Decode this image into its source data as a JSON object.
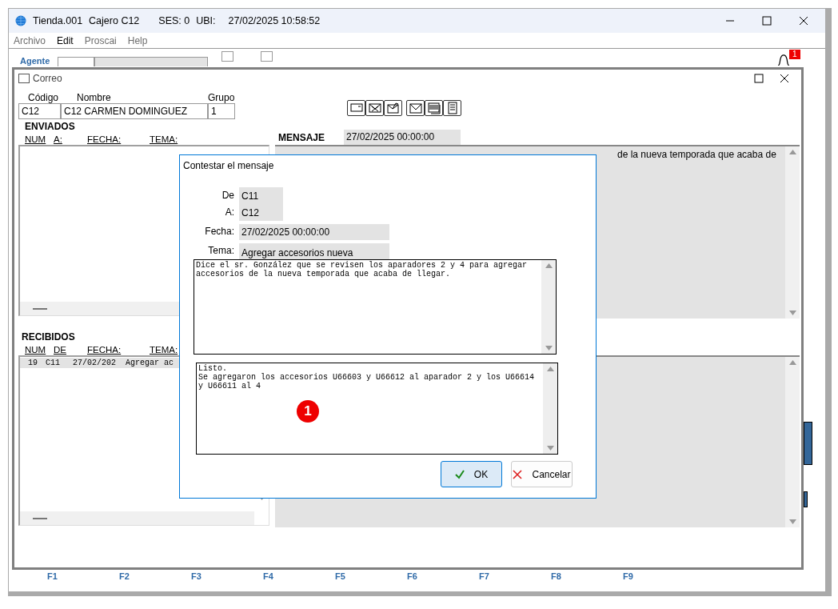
{
  "app_window": {
    "title": "Tienda.001",
    "cashier": "Cajero C12",
    "session": "SES: 0",
    "location_label": "UBI:",
    "datetime": "27/02/2025 10:58:52"
  },
  "menu": [
    {
      "label": "Archivo",
      "disabled": true
    },
    {
      "label": "Edit",
      "disabled": false
    },
    {
      "label": "Proscai",
      "disabled": true
    },
    {
      "label": "Help",
      "disabled": true
    }
  ],
  "agent": {
    "label": "Agente"
  },
  "checkboxes": [
    {
      "checked": false
    },
    {
      "checked": false
    }
  ],
  "notifications": {
    "count": "1"
  },
  "function_keys": [
    "F1",
    "F2",
    "F3",
    "F4",
    "F5",
    "F6",
    "F7",
    "F8",
    "F9"
  ],
  "mail_window": {
    "title": "Correo",
    "fields": [
      {
        "label": "Código",
        "value": "C12"
      },
      {
        "label": "Nombre",
        "value": "C12 CARMEN DOMINGUEZ"
      },
      {
        "label": "Grupo",
        "value": "1"
      }
    ],
    "sent": {
      "title": "ENVIADOS",
      "columns": [
        "NUM",
        "A:",
        "FECHA:",
        "TEMA:"
      ]
    },
    "message": {
      "label": "MENSAJE",
      "date": "27/02/2025 00:00:00",
      "text": "de la nueva temporada que acaba de"
    },
    "received": {
      "title": "RECIBIDOS",
      "columns": [
        "NUM",
        "DE",
        "FECHA:",
        "TEMA:"
      ],
      "rows": [
        {
          "cells": [
            "19",
            "C11",
            "27/02/202",
            "Agregar ac"
          ],
          "selected": true
        }
      ]
    }
  },
  "reply_dialog": {
    "title": "Contestar el mensaje",
    "from_label": "De",
    "from": "C11",
    "to_label": "A:",
    "to": "C12",
    "date_label": "Fecha:",
    "date": "27/02/2025 00:00:00",
    "subject_label": "Tema:",
    "subject": "Agregar accesorios nueva",
    "original_text": "Dice el sr. González que se revisen los aparadores 2 y 4 para agregar accesorios de la nueva temporada que acaba de llegar.",
    "reply_text": "Listo.\nSe agregaron los accesorios U66603 y U66612 al aparador 2 y los U66614 y U66611 al 4",
    "marker": "1",
    "buttons": [
      {
        "kind": "ok",
        "label": "OK",
        "default": true
      },
      {
        "kind": "cancel",
        "label": "Cancelar",
        "default": false
      }
    ]
  }
}
